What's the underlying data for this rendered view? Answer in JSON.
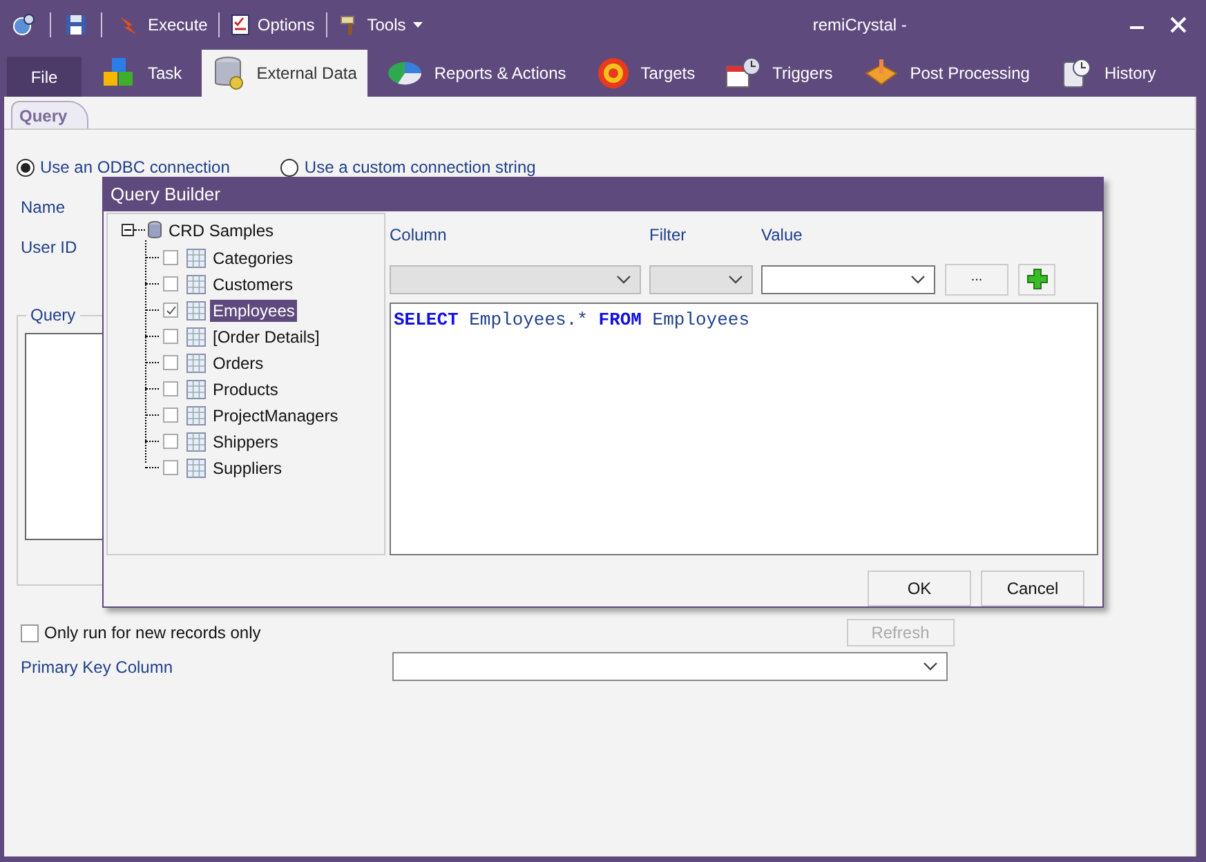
{
  "window": {
    "title": "remiCrystal -"
  },
  "toolbar": [
    {
      "kind": "button",
      "label": "Execute"
    },
    {
      "kind": "button",
      "label": "Options"
    },
    {
      "kind": "menu",
      "label": "Tools"
    }
  ],
  "ribbon_tabs": [
    {
      "kind": "file",
      "label": "File",
      "selected": false
    },
    {
      "kind": "tab",
      "label": "Task",
      "selected": false
    },
    {
      "kind": "tab",
      "label": "External Data",
      "selected": true
    },
    {
      "kind": "tab",
      "label": "Reports & Actions",
      "selected": false
    },
    {
      "kind": "tab",
      "label": "Targets",
      "selected": false
    },
    {
      "kind": "tab",
      "label": "Triggers",
      "selected": false
    },
    {
      "kind": "tab",
      "label": "Post Processing",
      "selected": false
    },
    {
      "kind": "tab",
      "label": "History",
      "selected": false
    }
  ],
  "page_tabs": [
    {
      "label": "Query",
      "selected": true
    }
  ],
  "connection_options": [
    {
      "label": "Use an ODBC connection",
      "selected": true
    },
    {
      "label": "Use a custom connection string",
      "selected": false
    }
  ],
  "field_labels": [
    "Name",
    "User ID"
  ],
  "query_group": {
    "label": "Query"
  },
  "only_new_records": {
    "label": "Only run for new records only",
    "checked": false
  },
  "refresh_button": {
    "label": "Refresh",
    "disabled": true
  },
  "primary_key": {
    "label": "Primary Key Column"
  },
  "dialog": {
    "title": "Query Builder",
    "tree": {
      "label": "CRD Samples",
      "expanded": true,
      "children": [
        {
          "label": "Categories",
          "checked": false,
          "selected": false
        },
        {
          "label": "Customers",
          "checked": false,
          "selected": false
        },
        {
          "label": "Employees",
          "checked": true,
          "selected": true
        },
        {
          "label": "[Order Details]",
          "checked": false,
          "selected": false
        },
        {
          "label": "Orders",
          "checked": false,
          "selected": false
        },
        {
          "label": "Products",
          "checked": false,
          "selected": false
        },
        {
          "label": "ProjectManagers",
          "checked": false,
          "selected": false
        },
        {
          "label": "Shippers",
          "checked": false,
          "selected": false
        },
        {
          "label": "Suppliers",
          "checked": false,
          "selected": false
        }
      ]
    },
    "filter_labels": [
      "Column",
      "Filter",
      "Value"
    ],
    "filter_fields": [
      {
        "disabled": true
      },
      {
        "disabled": true
      },
      {
        "disabled": false
      }
    ],
    "browse_button": "...",
    "sql": [
      {
        "kind": "keyword",
        "text": "SELECT"
      },
      {
        "kind": "plain",
        "text": "Employees.*"
      },
      {
        "kind": "keyword",
        "text": "FROM"
      },
      {
        "kind": "plain",
        "text": "Employees"
      }
    ],
    "buttons": [
      "OK",
      "Cancel"
    ]
  }
}
